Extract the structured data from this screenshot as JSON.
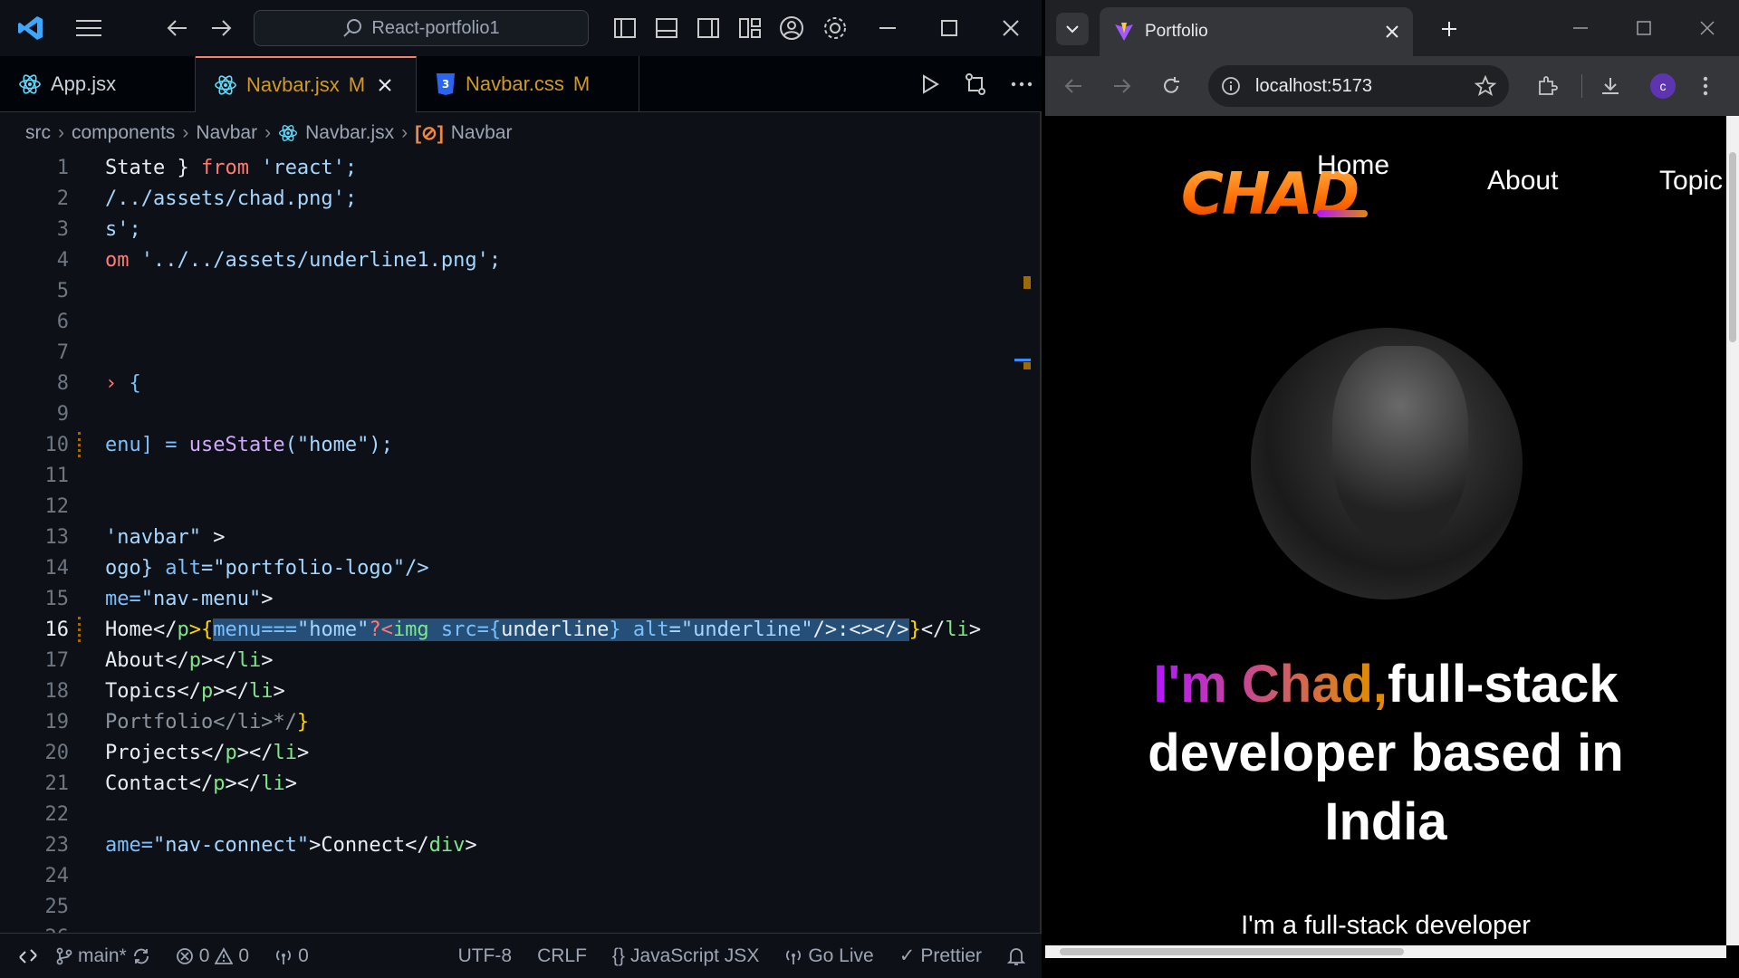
{
  "vscode": {
    "search_text": "React-portfolio1",
    "tabs": [
      {
        "label": "App.jsx",
        "modified": ""
      },
      {
        "label": "Navbar.jsx",
        "modified": "M"
      },
      {
        "label": "Navbar.css",
        "modified": "M"
      }
    ],
    "breadcrumb": [
      "src",
      "components",
      "Navbar",
      "Navbar.jsx",
      "Navbar"
    ],
    "line_numbers": [
      "1",
      "2",
      "3",
      "4",
      "5",
      "6",
      "7",
      "8",
      "9",
      "10",
      "11",
      "12",
      "13",
      "14",
      "15",
      "16",
      "17",
      "18",
      "19",
      "20",
      "21",
      "22",
      "23",
      "24",
      "25",
      "26"
    ],
    "code": {
      "l1a": "State } ",
      "l1b": "from",
      "l1c": " 'react';",
      "l2": "/../assets/chad.png';",
      "l3": "s';",
      "l4a": "om ",
      "l4b": "'../../assets/underline1.png';",
      "l8a": "› ",
      "l8b": "{",
      "l10a": "enu] = ",
      "l10b": "useState",
      "l10c": "(\"home\");",
      "l13a": "'navbar\"",
      "l13b": " >",
      "l14a": "ogo} ",
      "l14b": "alt",
      "l14c": "=\"portfolio-logo\"/>",
      "l15a": "me=",
      "l15b": "\"nav-menu\"",
      "l15c": ">",
      "l16a": "Home</",
      "l16b": "p",
      "l16c": ">{",
      "l16sel1": "menu===",
      "l16sel2": "\"home\"",
      "l16sel3": "?<",
      "l16sel4": "img",
      "l16sel5": " src={",
      "l16sel6": "underline",
      "l16sel7": "} ",
      "l16sel8": "alt",
      "l16sel9": "=\"underline\"",
      "l16sel10": "/>:<></>",
      "l16d": "}",
      "l16e": "</",
      "l16f": "li",
      "l16g": ">",
      "l17a": "About</",
      "l17b": "p",
      "l17c": "></",
      "l17d": "li",
      "l17e": ">",
      "l18a": "Topics</",
      "l18b": "p",
      "l18c": "></",
      "l18d": "li",
      "l18e": ">",
      "l19a": "Portfolio</li>*/",
      "l19b": "}",
      "l20a": "Projects</",
      "l20b": "p",
      "l20c": "></",
      "l20d": "li",
      "l20e": ">",
      "l21a": "Contact</",
      "l21b": "p",
      "l21c": "></",
      "l21d": "li",
      "l21e": ">",
      "l23a": "ame=",
      "l23b": "\"nav-connect\"",
      "l23c": ">Connect</",
      "l23d": "div",
      "l23e": ">"
    },
    "status": {
      "branch": "main*",
      "errors": "0",
      "warnings": "0",
      "ports": "0",
      "encoding": "UTF-8",
      "eol": "CRLF",
      "language": "JavaScript JSX",
      "golive": "Go Live",
      "prettier": "Prettier"
    }
  },
  "browser": {
    "tab_title": "Portfolio",
    "url": "localhost:5173",
    "avatar_letter": "c",
    "page": {
      "logo_text": "CHAD",
      "nav": [
        "Home",
        "About",
        "Topic"
      ],
      "headline_gradient": "I'm Chad,",
      "headline_rest_1": "full-stack",
      "headline_rest_2": "developer based in",
      "headline_rest_3": "India",
      "subtext": "I'm a full-stack developer"
    }
  },
  "colors": {
    "accent_gradient_start": "#b415ff",
    "accent_gradient_end": "#df8908",
    "selection": "#264f78",
    "logo_orange": "#ff6a00"
  }
}
